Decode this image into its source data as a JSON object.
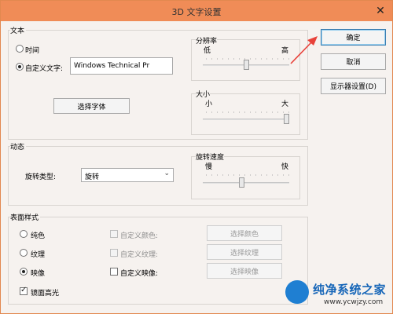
{
  "window": {
    "title": "3D 文字设置",
    "close_glyph": "✕"
  },
  "text_group": {
    "label": "文本",
    "time_label": "时间",
    "custom_text_label": "自定义文字:",
    "custom_text_value": "Windows Technical Pr",
    "choose_font": "选择字体",
    "resolution": {
      "label": "分辨率",
      "low": "低",
      "high": "高",
      "level": 0.5
    },
    "size": {
      "label": "大小",
      "small": "小",
      "large": "大",
      "level": 1.0
    }
  },
  "motion_group": {
    "label": "动态",
    "rotation_type_label": "旋转类型:",
    "rotation_type_value": "旋转",
    "speed": {
      "label": "旋转速度",
      "slow": "慢",
      "fast": "快",
      "level": 0.45
    }
  },
  "surface_group": {
    "label": "表面样式",
    "solid_label": "纯色",
    "texture_label": "纹理",
    "reflection_label": "映像",
    "custom_color_label": "自定义颜色:",
    "custom_texture_label": "自定义纹理:",
    "custom_reflection_label": "自定义映像:",
    "choose_color": "选择颜色",
    "choose_texture": "选择纹理",
    "choose_reflection": "选择映像",
    "specular_label": "镜面高光"
  },
  "buttons": {
    "ok": "确定",
    "cancel": "取消",
    "display_settings": "显示器设置(D)"
  },
  "watermark": {
    "brand": "纯净系统之家",
    "url": "www.ycwjzy.com"
  },
  "colors": {
    "titlebar": "#f08c57",
    "arrow": "#e8423a",
    "accent_border": "#3c7fb1"
  }
}
